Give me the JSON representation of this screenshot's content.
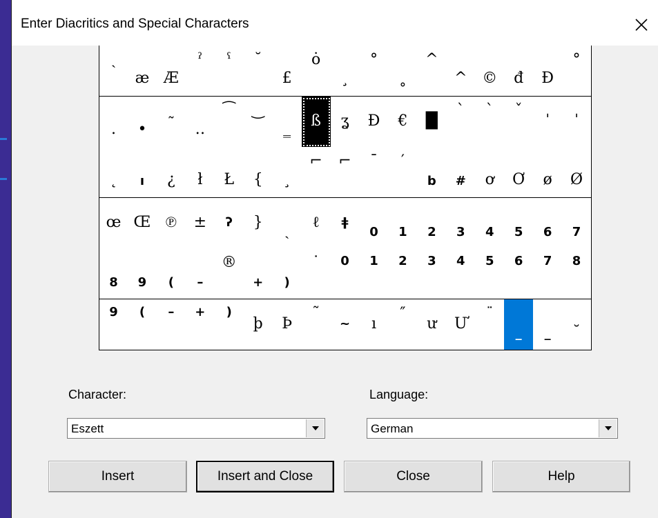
{
  "dialog": {
    "title": "Enter Diacritics and Special Characters",
    "close_icon": "close-icon"
  },
  "grid": {
    "columns": 17,
    "rows": 6,
    "selected_index": 24,
    "highlight_index": 99,
    "cells": [
      "ˏ",
      "æ",
      "Æ",
      "ˀ",
      "ˤ",
      "˘",
      "£",
      "ȯ",
      "¸",
      "°",
      "˳",
      "^",
      "^",
      "©",
      "đ",
      "Đ",
      "°",
      ".",
      "•",
      "˷",
      "‥",
      "⁀",
      "‿",
      "‗",
      "ß",
      "ʓ",
      "Ð",
      "€",
      "█",
      "ˋ",
      "ˋ",
      "ˇ",
      "ˌ",
      "ˌ",
      "˛",
      "ı",
      "¿",
      "ł",
      "Ł",
      "{",
      "¸",
      "⌐",
      "⌐",
      "¯",
      "′",
      "b",
      "#",
      "ơ",
      "Ơ",
      "ø",
      "Ø",
      "œ",
      "Œ",
      "℗",
      "±",
      "ʔ",
      "}",
      "ˏ",
      "ℓ",
      "ǂ",
      "0",
      "1",
      "2",
      "3",
      "4",
      "5",
      "6",
      "7",
      "8",
      "9",
      "(",
      "–",
      "®",
      "+",
      ")",
      "˙",
      "0",
      "1",
      "2",
      "3",
      "4",
      "5",
      "6",
      "7",
      "8",
      "9",
      "(",
      "–",
      "+",
      ")",
      "þ",
      "Þ",
      "˜",
      "~",
      "ı",
      "″",
      "ư",
      "Ư",
      "¨",
      "_",
      "_",
      "˘"
    ],
    "cell_vertical_align": [
      "top",
      "bottom",
      "bottom",
      "top",
      "top",
      "top",
      "bottom",
      "top",
      "bottom",
      "top",
      "bottom",
      "top",
      "bottom",
      "bottom",
      "bottom",
      "bottom",
      "top",
      "bottom",
      "bottom",
      "top",
      "bottom",
      "top",
      "top",
      "bottom",
      "center",
      "center",
      "center",
      "center",
      "center",
      "top",
      "top",
      "top",
      "top",
      "top",
      "bottom",
      "bottom",
      "bottom",
      "bottom",
      "bottom",
      "bottom",
      "bottom",
      "top",
      "top",
      "top",
      "top",
      "bottom",
      "bottom",
      "bottom",
      "bottom",
      "bottom",
      "bottom",
      "center",
      "center",
      "center",
      "center",
      "center",
      "center",
      "bottom",
      "center",
      "center",
      "bottom",
      "bottom",
      "bottom",
      "bottom",
      "bottom",
      "bottom",
      "bottom",
      "bottom",
      "bottom",
      "bottom",
      "bottom",
      "bottom",
      "top",
      "bottom",
      "bottom",
      "top",
      "top",
      "top",
      "top",
      "top",
      "top",
      "top",
      "top",
      "top",
      "top",
      "top",
      "top",
      "top",
      "top",
      "top",
      "center",
      "center",
      "top",
      "center",
      "center",
      "top",
      "center",
      "center",
      "top",
      "bottom",
      "bottom",
      "bottom"
    ],
    "cell_bold": [
      false,
      false,
      false,
      false,
      false,
      false,
      false,
      false,
      false,
      false,
      false,
      false,
      false,
      false,
      false,
      false,
      false,
      false,
      false,
      false,
      false,
      false,
      false,
      false,
      false,
      false,
      false,
      false,
      false,
      false,
      false,
      false,
      false,
      false,
      false,
      true,
      false,
      false,
      false,
      false,
      false,
      false,
      false,
      false,
      false,
      true,
      true,
      false,
      false,
      false,
      false,
      false,
      false,
      false,
      false,
      true,
      false,
      false,
      false,
      true,
      true,
      true,
      true,
      true,
      true,
      true,
      true,
      true,
      true,
      true,
      true,
      true,
      false,
      true,
      true,
      true,
      true,
      true,
      true,
      true,
      true,
      true,
      true,
      true,
      true,
      true,
      true,
      true,
      true,
      true,
      false,
      false,
      false,
      true,
      false,
      false,
      false,
      false,
      true,
      true,
      true,
      false
    ]
  },
  "character": {
    "label": "Character:",
    "value": "Eszett"
  },
  "language": {
    "label": "Language:",
    "value": "German"
  },
  "buttons": {
    "insert": "Insert",
    "insert_and_close": "Insert and Close",
    "close": "Close",
    "help": "Help"
  },
  "colors": {
    "selection": "#000000",
    "highlight": "#0078d7",
    "desktop": "#2c1d84"
  }
}
